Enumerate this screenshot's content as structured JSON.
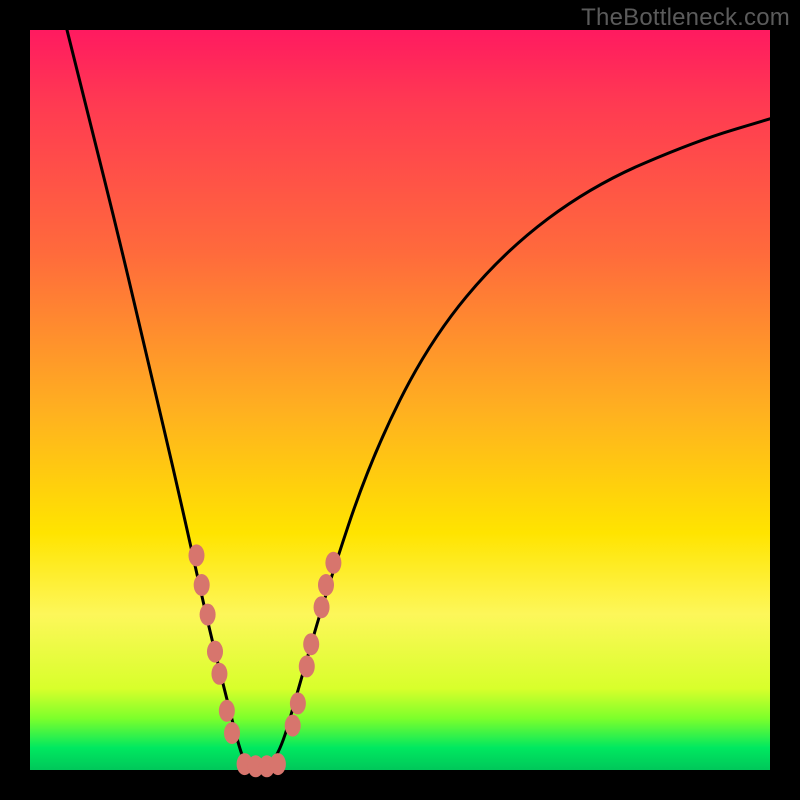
{
  "watermark": "TheBottleneck.com",
  "chart_data": {
    "type": "line",
    "title": "",
    "xlabel": "",
    "ylabel": "",
    "xlim": [
      0,
      100
    ],
    "ylim": [
      0,
      100
    ],
    "series": [
      {
        "name": "curve",
        "x": [
          5,
          8,
          12,
          16,
          20,
          24,
          26,
          28,
          29,
          30,
          32,
          34,
          36,
          40,
          46,
          54,
          64,
          76,
          90,
          100
        ],
        "y": [
          100,
          88,
          72,
          55,
          38,
          20,
          12,
          4,
          1,
          0,
          0,
          3,
          10,
          24,
          42,
          58,
          70,
          79,
          85,
          88
        ]
      }
    ],
    "markers": {
      "name": "dots",
      "color": "#d7756d",
      "points": [
        {
          "x": 22.5,
          "y": 29
        },
        {
          "x": 23.2,
          "y": 25
        },
        {
          "x": 24.0,
          "y": 21
        },
        {
          "x": 25.0,
          "y": 16
        },
        {
          "x": 25.6,
          "y": 13
        },
        {
          "x": 26.6,
          "y": 8
        },
        {
          "x": 27.3,
          "y": 5
        },
        {
          "x": 29.0,
          "y": 0.8
        },
        {
          "x": 30.5,
          "y": 0.5
        },
        {
          "x": 32.0,
          "y": 0.5
        },
        {
          "x": 33.5,
          "y": 0.8
        },
        {
          "x": 35.5,
          "y": 6
        },
        {
          "x": 36.2,
          "y": 9
        },
        {
          "x": 37.4,
          "y": 14
        },
        {
          "x": 38.0,
          "y": 17
        },
        {
          "x": 39.4,
          "y": 22
        },
        {
          "x": 40.0,
          "y": 25
        },
        {
          "x": 41.0,
          "y": 28
        }
      ]
    },
    "gradient_stops": [
      {
        "pos": 0,
        "color": "#ff1a60"
      },
      {
        "pos": 30,
        "color": "#ff6a3c"
      },
      {
        "pos": 68,
        "color": "#ffe400"
      },
      {
        "pos": 93,
        "color": "#7dff2b"
      },
      {
        "pos": 100,
        "color": "#00c75a"
      }
    ]
  }
}
